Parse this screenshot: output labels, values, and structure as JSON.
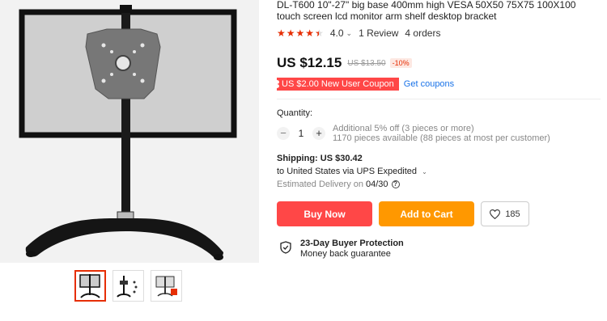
{
  "product": {
    "title": "DL-T600 10\"-27\" big base 400mm high VESA 50X50 75X75 100X100 touch screen lcd monitor arm shelf desktop bracket",
    "rating": "4.0",
    "reviews": "1 Review",
    "orders": "4 orders",
    "rating_stars": 4,
    "rating_max": 5
  },
  "pricing": {
    "price": "US $12.15",
    "old_price": "US $13.50",
    "discount": "-10%",
    "coupon": "US $2.00 New User Coupon",
    "get_coupons": "Get coupons"
  },
  "quantity": {
    "label": "Quantity:",
    "value": "1",
    "minus": "−",
    "plus": "+",
    "note_additional": "Additional 5% off (3 pieces or more)",
    "note_available": "1170 pieces available (88 pieces at most per customer)"
  },
  "shipping": {
    "title": "Shipping: US $30.42",
    "to": "to United States via UPS Expedited",
    "estimated_label": "Estimated Delivery on",
    "estimated_date": "04/30",
    "help": "?"
  },
  "actions": {
    "buy_now": "Buy Now",
    "add_to_cart": "Add to Cart",
    "wishlist_count": "185"
  },
  "protection": {
    "title": "23-Day Buyer Protection",
    "subtitle": "Money back guarantee"
  },
  "gallery": {
    "thumbnail_count": 3,
    "active_index": 0
  },
  "colors": {
    "accent_red": "#ff4747",
    "accent_orange": "#ff9800",
    "link_blue": "#1a73e8"
  }
}
